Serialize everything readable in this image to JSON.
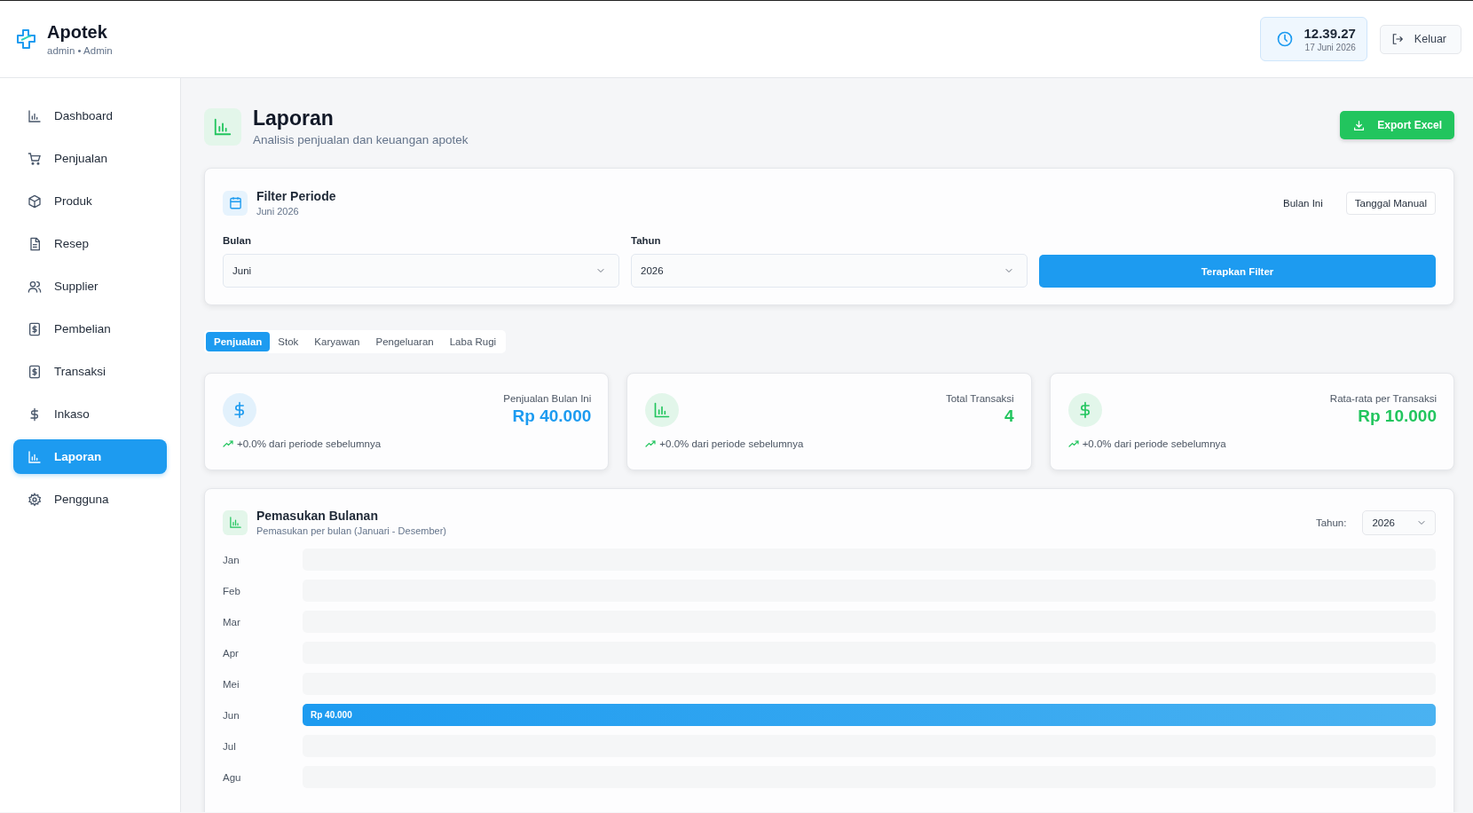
{
  "app": {
    "title": "Apotek",
    "subtitle": "admin • Admin"
  },
  "clock": {
    "time": "12.39.27",
    "date": "17 Juni 2026"
  },
  "logout": {
    "label": "Keluar"
  },
  "sidebar": {
    "items": [
      {
        "label": "Dashboard",
        "selected": false
      },
      {
        "label": "Penjualan",
        "selected": false
      },
      {
        "label": "Produk",
        "selected": false
      },
      {
        "label": "Resep",
        "selected": false
      },
      {
        "label": "Supplier",
        "selected": false
      },
      {
        "label": "Pembelian",
        "selected": false
      },
      {
        "label": "Transaksi",
        "selected": false
      },
      {
        "label": "Inkaso",
        "selected": false
      },
      {
        "label": "Laporan",
        "selected": true
      },
      {
        "label": "Pengguna",
        "selected": false
      }
    ]
  },
  "page": {
    "title": "Laporan",
    "subtitle": "Analisis penjualan dan keuangan apotek",
    "export_button": "Export Excel"
  },
  "filter": {
    "title": "Filter Periode",
    "subtitle": "Juni 2026",
    "modes": [
      {
        "label": "Bulan Ini",
        "selected": false
      },
      {
        "label": "Tanggal Manual",
        "selected": true
      }
    ],
    "month_label": "Bulan",
    "month_value": "Juni",
    "year_label": "Tahun",
    "year_value": "2026",
    "apply_button": "Terapkan Filter"
  },
  "tabs": [
    {
      "label": "Penjualan",
      "selected": true
    },
    {
      "label": "Stok",
      "selected": false
    },
    {
      "label": "Karyawan",
      "selected": false
    },
    {
      "label": "Pengeluaran",
      "selected": false
    },
    {
      "label": "Laba Rugi",
      "selected": false
    }
  ],
  "stats": [
    {
      "label": "Penjualan Bulan Ini",
      "value": "Rp 40.000",
      "change": "+0.0% dari periode sebelumnya",
      "color": "#1d9bf0"
    },
    {
      "label": "Total Transaksi",
      "value": "4",
      "change": "+0.0% dari periode sebelumnya",
      "color": "#22c55e"
    },
    {
      "label": "Rata-rata per Transaksi",
      "value": "Rp 10.000",
      "change": "+0.0% dari periode sebelumnya",
      "color": "#22c55e"
    }
  ],
  "income": {
    "title": "Pemasukan Bulanan",
    "subtitle": "Pemasukan per bulan (Januari - Desember)",
    "year_label": "Tahun:",
    "year_value": "2026",
    "months": [
      {
        "label": "Jan"
      },
      {
        "label": "Feb"
      },
      {
        "label": "Mar"
      },
      {
        "label": "Apr"
      },
      {
        "label": "Mei"
      },
      {
        "label": "Jun",
        "level": 1,
        "value": "Rp 40.000"
      },
      {
        "label": "Jul"
      },
      {
        "label": "Agu"
      }
    ]
  }
}
